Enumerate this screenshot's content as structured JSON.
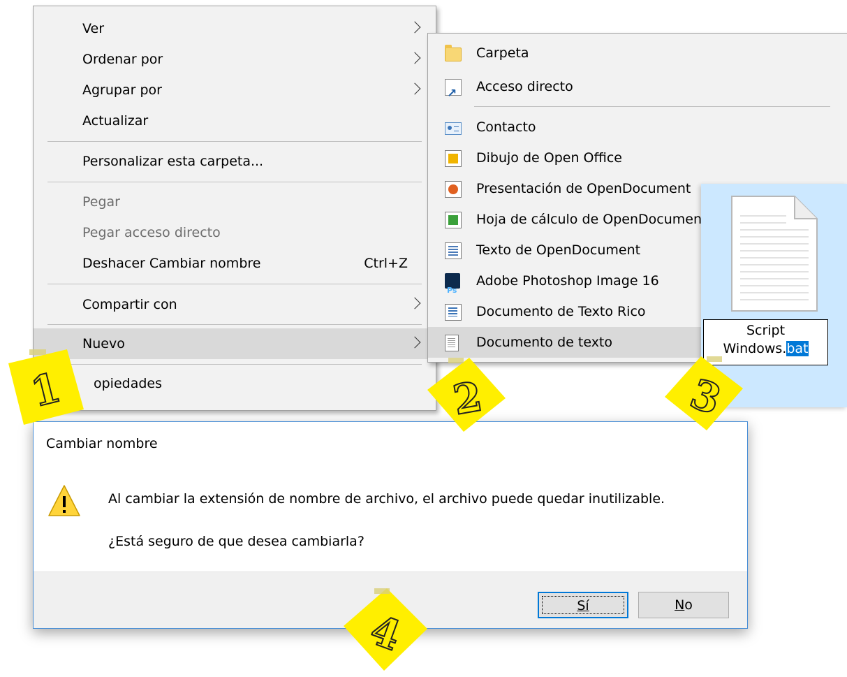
{
  "context_menu": {
    "items": [
      {
        "label": "Ver",
        "submenu": true
      },
      {
        "label": "Ordenar por",
        "submenu": true
      },
      {
        "label": "Agrupar por",
        "submenu": true
      },
      {
        "label": "Actualizar"
      },
      {
        "label": "Personalizar esta carpeta..."
      },
      {
        "label": "Pegar",
        "disabled": true
      },
      {
        "label": "Pegar acceso directo",
        "disabled": true
      },
      {
        "label": "Deshacer Cambiar nombre",
        "shortcut": "Ctrl+Z"
      },
      {
        "label": "Compartir con",
        "submenu": true
      },
      {
        "label": "Nuevo",
        "submenu": true,
        "highlighted": true
      },
      {
        "label": "Propiedades",
        "visible_text": "opiedades"
      }
    ]
  },
  "submenu_nuevo": {
    "items": [
      {
        "label": "Carpeta",
        "icon": "folder-icon"
      },
      {
        "label": "Acceso directo",
        "icon": "shortcut-icon"
      },
      {
        "label": "Contacto",
        "icon": "contact-icon"
      },
      {
        "label": "Dibujo de Open Office",
        "icon": "opendocument-drawing-icon"
      },
      {
        "label": "Presentación de OpenDocument",
        "icon": "opendocument-presentation-icon"
      },
      {
        "label": "Hoja de cálculo de OpenDocument",
        "icon": "opendocument-spreadsheet-icon"
      },
      {
        "label": "Texto de OpenDocument",
        "icon": "opendocument-text-icon"
      },
      {
        "label": "Adobe Photoshop Image 16",
        "icon": "photoshop-icon"
      },
      {
        "label": "Documento de Texto Rico",
        "icon": "rich-text-icon"
      },
      {
        "label": "Documento de texto",
        "icon": "text-document-icon",
        "highlighted": true
      }
    ]
  },
  "file": {
    "name_line1": "Script",
    "name_base": "Windows.",
    "name_ext": "bat"
  },
  "dialog": {
    "title": "Cambiar nombre",
    "message": "Al cambiar la extensión de nombre de archivo, el archivo puede quedar inutilizable.",
    "question": "¿Está seguro de que desea cambiarla?",
    "yes_label": "Sí",
    "no_label": "No"
  },
  "steps": [
    "1",
    "2",
    "3",
    "4"
  ],
  "colors": {
    "selection": "#0078d7",
    "sticky_note": "#ffef00",
    "menu_bg": "#f2f2f2",
    "file_panel_bg": "#cce8ff"
  }
}
